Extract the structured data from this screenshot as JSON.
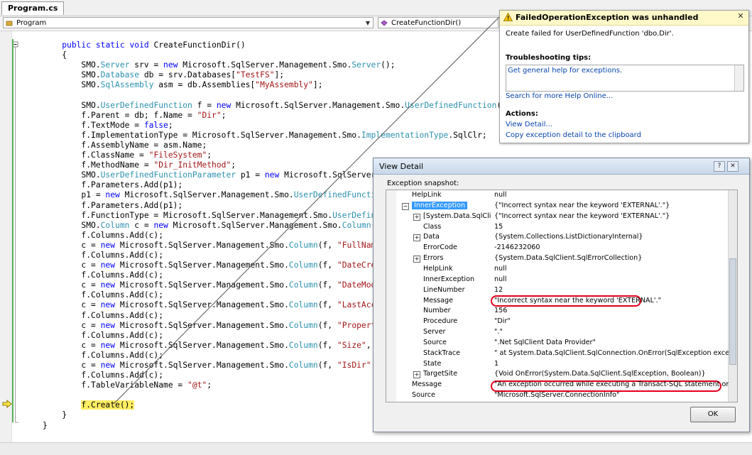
{
  "editor": {
    "tab": "Program.cs",
    "class_combo": "Program",
    "member_combo": "CreateFunctionDir()",
    "code": [
      [
        [
          "    ",
          ""
        ],
        [
          "public",
          "kw"
        ],
        [
          " ",
          ""
        ],
        [
          "static",
          "kw"
        ],
        [
          " ",
          ""
        ],
        [
          "void",
          "kw"
        ],
        [
          " CreateFunctionDir()",
          ""
        ]
      ],
      [
        [
          "    {",
          ""
        ]
      ],
      [
        [
          "        SMO.",
          ""
        ],
        [
          "Server",
          "ty"
        ],
        [
          " srv = ",
          ""
        ],
        [
          "new",
          "kw"
        ],
        [
          " Microsoft.SqlServer.Management.Smo.",
          ""
        ],
        [
          "Server",
          "ty"
        ],
        [
          "();",
          ""
        ]
      ],
      [
        [
          "        SMO.",
          ""
        ],
        [
          "Database",
          "ty"
        ],
        [
          " db = srv.Databases[",
          ""
        ],
        [
          "\"TestFS\"",
          "st"
        ],
        [
          "];",
          ""
        ]
      ],
      [
        [
          "        SMO.",
          ""
        ],
        [
          "SqlAssembly",
          "ty"
        ],
        [
          " asm = db.Assemblies[",
          ""
        ],
        [
          "\"MyAssembly\"",
          "st"
        ],
        [
          "];",
          ""
        ]
      ],
      [
        [
          "",
          ""
        ]
      ],
      [
        [
          "        SMO.",
          ""
        ],
        [
          "UserDefinedFunction",
          "ty"
        ],
        [
          " f = ",
          ""
        ],
        [
          "new",
          "kw"
        ],
        [
          " Microsoft.SqlServer.Management.Smo.",
          ""
        ],
        [
          "UserDefinedFunction",
          "ty"
        ],
        [
          "(",
          ""
        ]
      ],
      [
        [
          "        f.Parent = db; f.Name = ",
          ""
        ],
        [
          "\"Dir\"",
          "st"
        ],
        [
          ";",
          ""
        ]
      ],
      [
        [
          "        f.TextMode = ",
          ""
        ],
        [
          "false",
          "kw"
        ],
        [
          ";",
          ""
        ]
      ],
      [
        [
          "        f.ImplementationType = Microsoft.SqlServer.Management.Smo.",
          ""
        ],
        [
          "ImplementationType",
          "ty"
        ],
        [
          ".SqlClr;",
          ""
        ]
      ],
      [
        [
          "        f.AssemblyName = asm.Name;",
          ""
        ]
      ],
      [
        [
          "        f.ClassName = ",
          ""
        ],
        [
          "\"FileSystem\"",
          "st"
        ],
        [
          ";",
          ""
        ]
      ],
      [
        [
          "        f.MethodName = ",
          ""
        ],
        [
          "\"Dir_InitMethod\"",
          "st"
        ],
        [
          ";",
          ""
        ]
      ],
      [
        [
          "        SMO.",
          ""
        ],
        [
          "UserDefinedFunctionParameter",
          "ty"
        ],
        [
          " p1 = ",
          ""
        ],
        [
          "new",
          "kw"
        ],
        [
          " Microsoft.SqlServer.M",
          ""
        ]
      ],
      [
        [
          "        f.Parameters.Add(p1);",
          ""
        ]
      ],
      [
        [
          "        p1 = ",
          ""
        ],
        [
          "new",
          "kw"
        ],
        [
          " Microsoft.SqlServer.Management.Smo.",
          ""
        ],
        [
          "UserDefinedFunctio",
          "ty"
        ]
      ],
      [
        [
          "        f.Parameters.Add(p1);",
          ""
        ]
      ],
      [
        [
          "        f.FunctionType = Microsoft.SqlServer.Management.Smo.",
          ""
        ],
        [
          "UserDefine",
          "ty"
        ]
      ],
      [
        [
          "        SMO.",
          ""
        ],
        [
          "Column",
          "ty"
        ],
        [
          " c = ",
          ""
        ],
        [
          "new",
          "kw"
        ],
        [
          " Microsoft.SqlServer.Management.Smo.",
          ""
        ],
        [
          "Column",
          "ty"
        ],
        [
          "(f",
          ""
        ]
      ],
      [
        [
          "        f.Columns.Add(c);",
          ""
        ]
      ],
      [
        [
          "        c = ",
          ""
        ],
        [
          "new",
          "kw"
        ],
        [
          " Microsoft.SqlServer.Management.Smo.",
          ""
        ],
        [
          "Column",
          "ty"
        ],
        [
          "(f, ",
          ""
        ],
        [
          "\"FullName",
          "st"
        ]
      ],
      [
        [
          "        f.Columns.Add(c);",
          ""
        ]
      ],
      [
        [
          "        c = ",
          ""
        ],
        [
          "new",
          "kw"
        ],
        [
          " Microsoft.SqlServer.Management.Smo.",
          ""
        ],
        [
          "Column",
          "ty"
        ],
        [
          "(f, ",
          ""
        ],
        [
          "\"DateCrea",
          "st"
        ]
      ],
      [
        [
          "        f.Columns.Add(c);",
          ""
        ]
      ],
      [
        [
          "        c = ",
          ""
        ],
        [
          "new",
          "kw"
        ],
        [
          " Microsoft.SqlServer.Management.Smo.",
          ""
        ],
        [
          "Column",
          "ty"
        ],
        [
          "(f, ",
          ""
        ],
        [
          "\"DateModi",
          "st"
        ]
      ],
      [
        [
          "        f.Columns.Add(c);",
          ""
        ]
      ],
      [
        [
          "        c = ",
          ""
        ],
        [
          "new",
          "kw"
        ],
        [
          " Microsoft.SqlServer.Management.Smo.",
          ""
        ],
        [
          "Column",
          "ty"
        ],
        [
          "(f, ",
          ""
        ],
        [
          "\"LastAcce",
          "st"
        ]
      ],
      [
        [
          "        f.Columns.Add(c);",
          ""
        ]
      ],
      [
        [
          "        c = ",
          ""
        ],
        [
          "new",
          "kw"
        ],
        [
          " Microsoft.SqlServer.Management.Smo.",
          ""
        ],
        [
          "Column",
          "ty"
        ],
        [
          "(f, ",
          ""
        ],
        [
          "\"Properti",
          "st"
        ]
      ],
      [
        [
          "        f.Columns.Add(c);",
          ""
        ]
      ],
      [
        [
          "        c = ",
          ""
        ],
        [
          "new",
          "kw"
        ],
        [
          " Microsoft.SqlServer.Management.Smo.",
          ""
        ],
        [
          "Column",
          "ty"
        ],
        [
          "(f, ",
          ""
        ],
        [
          "\"Size\"",
          "st"
        ],
        [
          ", S",
          ""
        ]
      ],
      [
        [
          "        f.Columns.Add(c);",
          ""
        ]
      ],
      [
        [
          "        c = ",
          ""
        ],
        [
          "new",
          "kw"
        ],
        [
          " Microsoft.SqlServer.Management.Smo.",
          ""
        ],
        [
          "Column",
          "ty"
        ],
        [
          "(f, ",
          ""
        ],
        [
          "\"IsDir\"",
          "st"
        ],
        [
          ", ",
          ""
        ]
      ],
      [
        [
          "        f.Columns.Add(c);",
          ""
        ]
      ],
      [
        [
          "        f.TableVariableName = ",
          ""
        ],
        [
          "\"@t\"",
          "st"
        ],
        [
          ";",
          ""
        ]
      ],
      [
        [
          "",
          ""
        ]
      ],
      [
        [
          "        ",
          ""
        ],
        [
          "f.Create();",
          "hl"
        ]
      ],
      [
        [
          "    }",
          ""
        ]
      ],
      [
        [
          "}",
          ""
        ]
      ]
    ]
  },
  "assistant": {
    "title": "FailedOperationException was unhandled",
    "message": "Create failed for UserDefinedFunction 'dbo.Dir'.",
    "tips_heading": "Troubleshooting tips:",
    "tip_link": "Get general help for exceptions.",
    "search_link": "Search for more Help Online...",
    "actions_heading": "Actions:",
    "action_view": "View Detail...",
    "action_copy": "Copy exception detail to the clipboard"
  },
  "dialog": {
    "title": "View Detail",
    "snapshot_label": "Exception snapshot:",
    "ok_label": "OK",
    "rows": [
      {
        "indent": 1,
        "name": "HelpLink",
        "value": "null"
      },
      {
        "indent": 1,
        "name": "InnerException",
        "value": "{\"Incorrect syntax near the keyword 'EXTERNAL'.\"}",
        "expander": "−",
        "selected": true
      },
      {
        "indent": 2,
        "name": "[System.Data.SqlClient.S",
        "value": "{\"Incorrect syntax near the keyword 'EXTERNAL'.\"}",
        "expander": "+"
      },
      {
        "indent": 2,
        "name": "Class",
        "value": "15"
      },
      {
        "indent": 2,
        "name": "Data",
        "value": "{System.Collections.ListDictionaryInternal}",
        "expander": "+"
      },
      {
        "indent": 2,
        "name": "ErrorCode",
        "value": "-2146232060"
      },
      {
        "indent": 2,
        "name": "Errors",
        "value": "{System.Data.SqlClient.SqlErrorCollection}",
        "expander": "+"
      },
      {
        "indent": 2,
        "name": "HelpLink",
        "value": "null"
      },
      {
        "indent": 2,
        "name": "InnerException",
        "value": "null"
      },
      {
        "indent": 2,
        "name": "LineNumber",
        "value": "12"
      },
      {
        "indent": 2,
        "name": "Message",
        "value": "\"Incorrect syntax near the keyword 'EXTERNAL'.\""
      },
      {
        "indent": 2,
        "name": "Number",
        "value": "156"
      },
      {
        "indent": 2,
        "name": "Procedure",
        "value": "\"Dir\""
      },
      {
        "indent": 2,
        "name": "Server",
        "value": "\".\""
      },
      {
        "indent": 2,
        "name": "Source",
        "value": "\".Net SqlClient Data Provider\""
      },
      {
        "indent": 2,
        "name": "StackTrace",
        "value": "\"   at System.Data.SqlClient.SqlConnection.OnError(SqlException exception, Bool"
      },
      {
        "indent": 2,
        "name": "State",
        "value": "1"
      },
      {
        "indent": 2,
        "name": "TargetSite",
        "value": "{Void OnError(System.Data.SqlClient.SqlException, Boolean)}",
        "expander": "+"
      },
      {
        "indent": 0,
        "name": "Message",
        "value": "\"An exception occurred while executing a Transact-SQL statement or batch.\""
      },
      {
        "indent": 0,
        "name": "Source",
        "value": "\"Microsoft.SqlServer.ConnectionInfo\""
      }
    ]
  },
  "colors": {
    "keyword": "#0000ff",
    "type": "#2b91af",
    "string": "#a31515",
    "current_line": "#ffee62",
    "highlight_oval": "#e0001a"
  },
  "icons": [
    "class-icon",
    "method-icon",
    "warning-icon",
    "close-icon",
    "help-icon",
    "dialog-close-icon",
    "current-statement-arrow-icon"
  ]
}
